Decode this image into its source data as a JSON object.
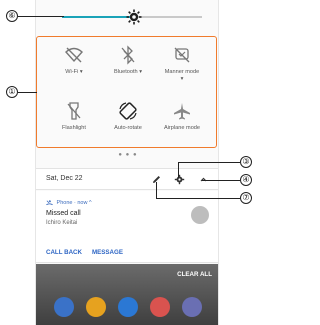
{
  "callouts": {
    "c6": "⑥",
    "c1": "①",
    "c3": "③",
    "c4": "④",
    "c7": "⑦"
  },
  "quick_settings": {
    "tiles": [
      {
        "label": "Wi-Fi ▾",
        "icon": "wifi-off-icon"
      },
      {
        "label": "Bluetooth ▾",
        "icon": "bluetooth-off-icon"
      },
      {
        "label": "Manner mode ▾",
        "icon": "manner-mode-icon"
      },
      {
        "label": "Flashlight",
        "icon": "flashlight-icon"
      },
      {
        "label": "Auto-rotate",
        "icon": "auto-rotate-icon"
      },
      {
        "label": "Airplane mode",
        "icon": "airplane-icon"
      }
    ],
    "pager": "● ● ●"
  },
  "date_row": {
    "date": "Sat, Dec 22"
  },
  "notification": {
    "app": "Phone · now ^",
    "title": "Missed call",
    "subtitle": "Ichiro Keitai",
    "actions": [
      "CALL BACK",
      "MESSAGE"
    ]
  },
  "home": {
    "clear_all": "CLEAR ALL"
  },
  "colors": {
    "accent": "#f07b2c",
    "link": "#2e66c4",
    "slider": "#1aa3b8"
  }
}
